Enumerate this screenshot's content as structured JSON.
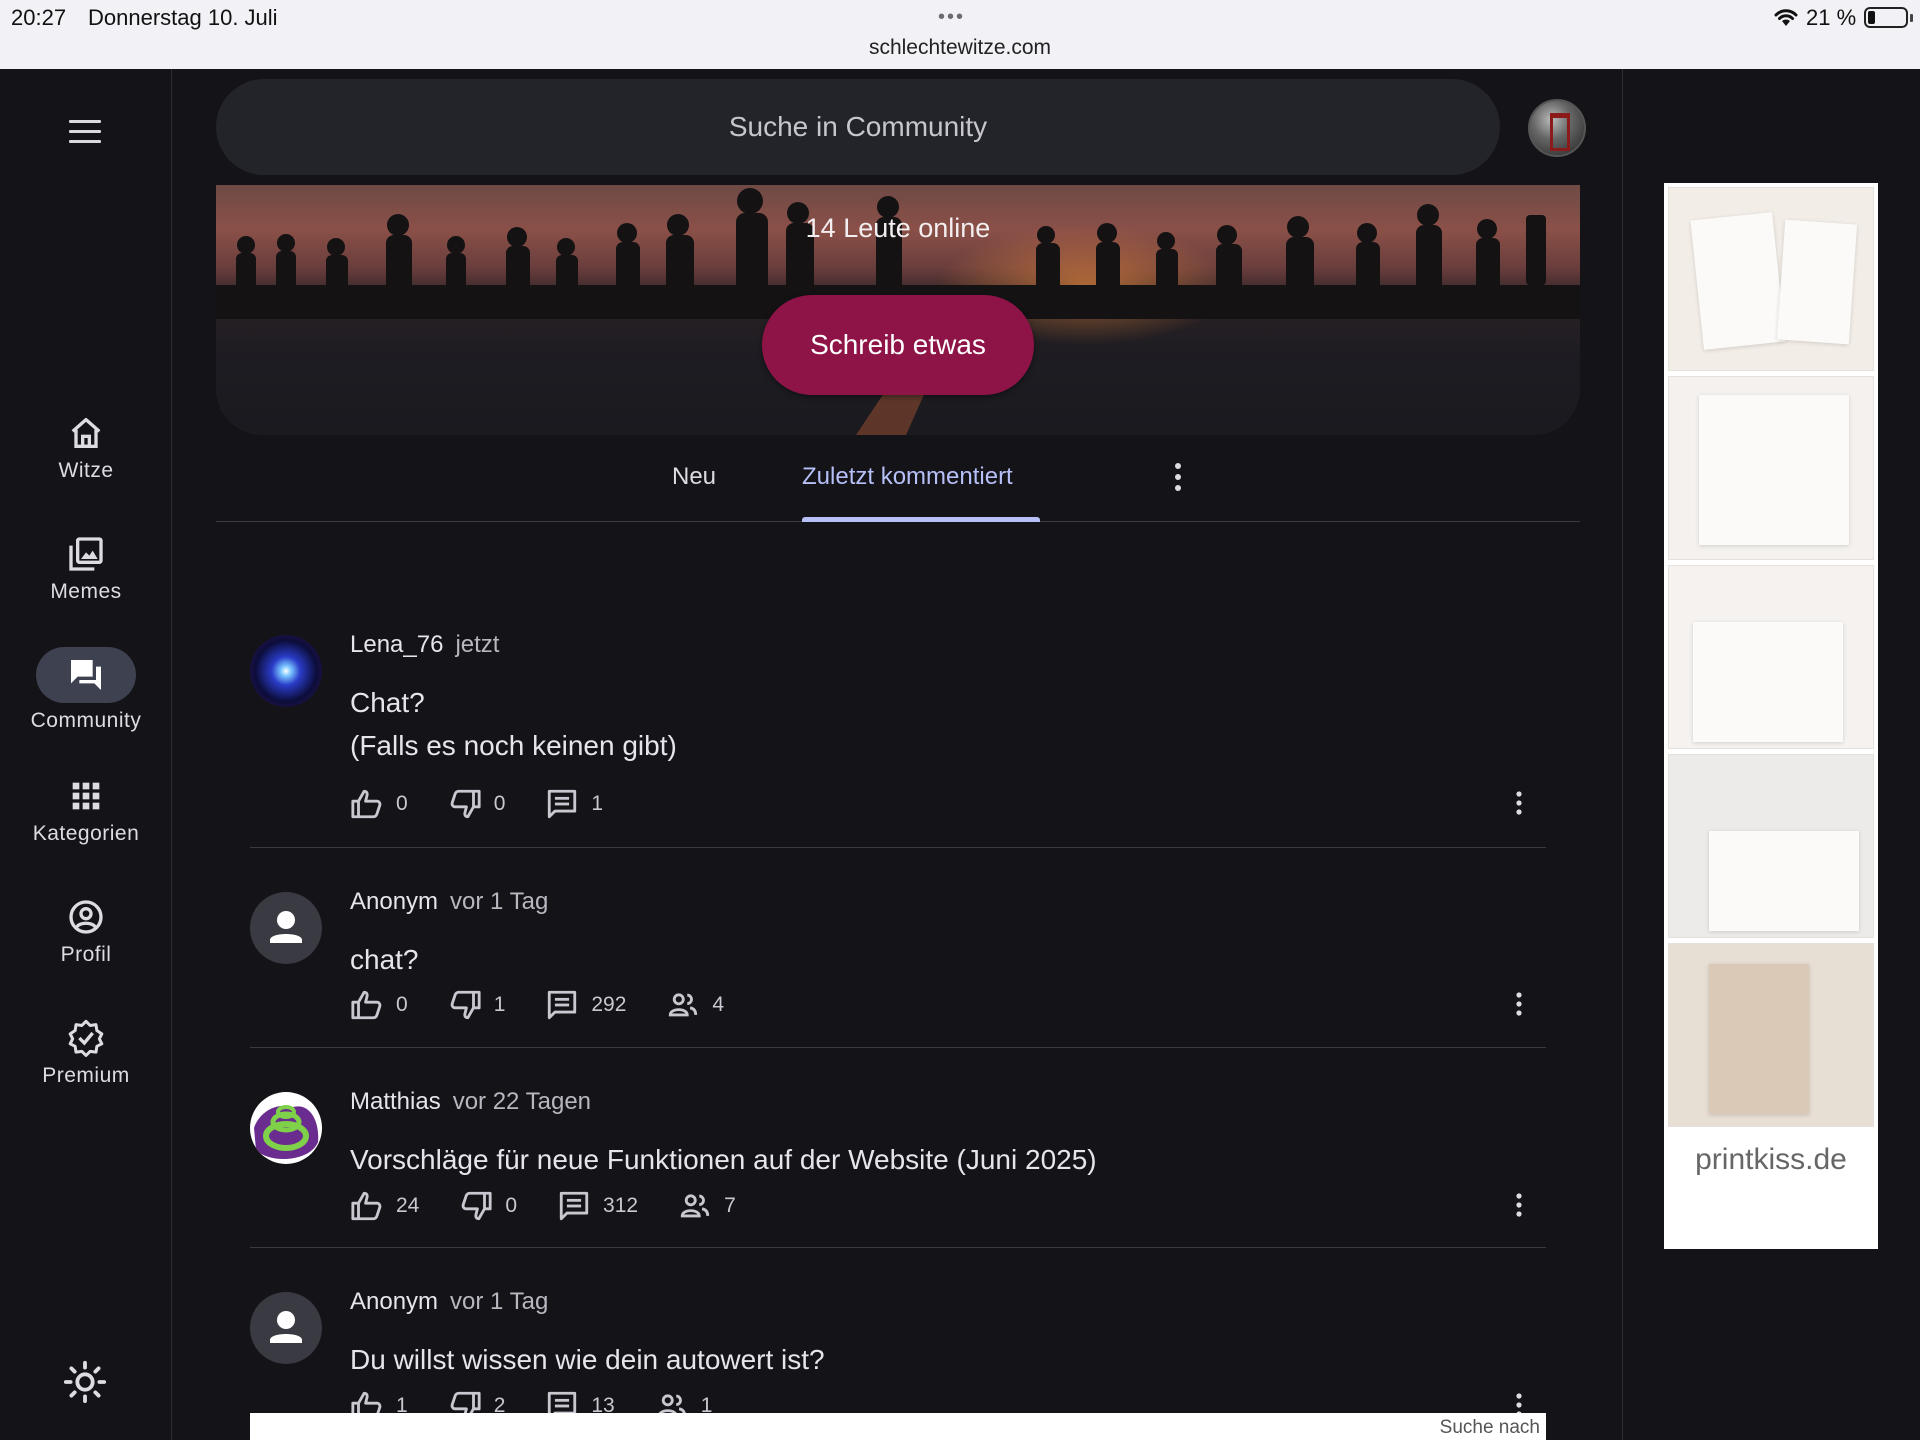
{
  "statusbar": {
    "time": "20:27",
    "date": "Donnerstag 10. Juli",
    "dots": "•••",
    "url": "schlechtewitze.com",
    "battery_percent": "21 %"
  },
  "nav": {
    "items": [
      {
        "label": "Witze",
        "icon": "home-icon"
      },
      {
        "label": "Memes",
        "icon": "image-gallery-icon"
      },
      {
        "label": "Community",
        "icon": "forum-icon",
        "active": true
      },
      {
        "label": "Kategorien",
        "icon": "grid-icon"
      },
      {
        "label": "Profil",
        "icon": "account-circle-icon"
      },
      {
        "label": "Premium",
        "icon": "verified-badge-icon"
      }
    ]
  },
  "search": {
    "placeholder": "Suche in Community"
  },
  "hero": {
    "online_text": "14 Leute online",
    "cta_label": "Schreib etwas"
  },
  "tabs": {
    "items": [
      "Neu",
      "Zuletzt kommentiert"
    ],
    "active": "Zuletzt kommentiert"
  },
  "posts": [
    {
      "user": "Lena_76",
      "time": "jetzt",
      "text": "Chat?\n(Falls es noch keinen gibt)",
      "likes": "0",
      "dislikes": "0",
      "comments": "1",
      "participants": ""
    },
    {
      "user": "Anonym",
      "time": "vor 1 Tag",
      "text": "chat?",
      "likes": "0",
      "dislikes": "1",
      "comments": "292",
      "participants": "4"
    },
    {
      "user": "Matthias",
      "time": "vor 22 Tagen",
      "text": "Vorschläge für neue Funktionen auf der Website (Juni 2025)",
      "likes": "24",
      "dislikes": "0",
      "comments": "312",
      "participants": "7"
    },
    {
      "user": "Anonym",
      "time": "vor 1 Tag",
      "text": "Du willst wissen wie dein autowert ist?",
      "likes": "1",
      "dislikes": "2",
      "comments": "13",
      "participants": "1"
    }
  ],
  "bottom_card": {
    "text": "Suche nach"
  },
  "ad": {
    "brand": "printkiss.de"
  },
  "colors": {
    "background": "#131318",
    "accent_tab": "#b7bff7",
    "cta": "#8e1447"
  }
}
